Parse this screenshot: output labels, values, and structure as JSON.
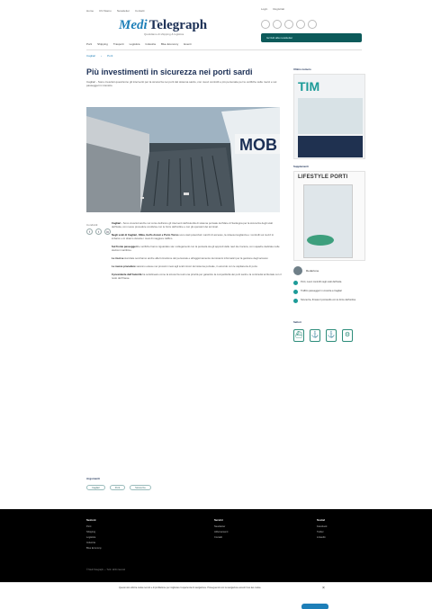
{
  "topbar": {
    "links": [
      "Home",
      "Chi Siamo",
      "Newsletter",
      "Contatti"
    ],
    "right_links": [
      "Login",
      "Registrati"
    ]
  },
  "header": {
    "logo_part1": "Medi",
    "logo_part2": "Telegraph",
    "tagline": "Quotidiano di shipping & logistica",
    "subscribe_label": "Iscriviti alla newsletter"
  },
  "nav": {
    "items": [
      "Porti",
      "Shipping",
      "Trasporti",
      "Logistica",
      "Industria",
      "Blue Economy",
      "Eventi"
    ]
  },
  "breadcrumbs": [
    "Cagliari",
    "Porti"
  ],
  "article": {
    "title": "Più investimenti in sicurezza nei porti sardi",
    "lead": "Cagliari - Sono cresciuti quest'anno gli interventi per la sicurezza nei porti del sistema sardo, con nuovi controlli e più personale per le verifiche sulle merci e sui passeggeri in transito.",
    "share_label": "Condividi",
    "share_icons": [
      "facebook-icon",
      "twitter-icon",
      "linkedin-icon"
    ],
    "paragraphs": [
      {
        "strong": "Cagliari - ",
        "text": "Sono cresciuti anche nel corso dell'anno gli interventi dell'Autorità di sistema portuale del Mare di Sardegna per la sicurezza degli scali dell'isola, con nuove procedure condivise con le forze dell'ordine e con gli operatori dei terminal."
      },
      {
        "strong": "Negli scali di Cagliari, Olbia, Golfo Aranci e Porto Torres ",
        "text": "sono stati potenziati i varchi di accesso, la videosorveglianza e i controlli sui mezzi in imbarco e in sbarco durante i mesi di maggiore traffico."
      },
      {
        "strong": "Sul fronte passeggeri ",
        "text": "le verifiche hanno riguardato sia i collegamenti con la penisola sia gli approdi delle navi da crociera, con squadre dedicate nelle stazioni marittime."
      },
      {
        "strong": "Le risorse ",
        "text": "stanziate serviranno anche alla formazione del personale e all'aggiornamento dei sistemi informatici per la gestione degli accessi."
      },
      {
        "strong": "Le nuove procedure ",
        "text": "saranno estese nei prossimi mesi agli scali minori del sistema portuale, in accordo con le capitanerie di porto."
      },
      {
        "strong": "Il presidente dell'Autorità ",
        "text": "ha sottolineato come la sicurezza resti una priorità per garantire la competitività dei porti sardi e la continuità territoriale con il resto del Paese."
      }
    ]
  },
  "tags": {
    "label": "Argomenti",
    "items": [
      "Cagliari",
      "Porti",
      "Sicurezza"
    ]
  },
  "sidebar": {
    "section1_label": "Ultimo numero",
    "ad1_title": "TIM",
    "section2_label": "Supplementi",
    "ad2_title": "LIFESTYLE PORTI",
    "author_name": "Redazione",
    "related": [
      "Porti, nuovi controlli negli scali dell'isola",
      "Traffico passeggeri in crescita a Cagliari",
      "Sicurezza, firmato il protocollo con le forze dell'ordine"
    ],
    "icons_label": "Settori",
    "sector_icons": [
      "ship-icon",
      "port-icon",
      "anchor-icon",
      "industry-icon",
      "wind-icon",
      "leaf-icon"
    ]
  },
  "footer": {
    "col1_title": "Sezioni",
    "col1_items": [
      "Porti",
      "Shipping",
      "Logistica",
      "Industria",
      "Blue Economy"
    ],
    "col2_title": "Servizi",
    "col2_items": [
      "Newsletter",
      "Abbonamenti",
      "Contatti"
    ],
    "col3_title": "Social",
    "col3_items": [
      "Facebook",
      "Twitter",
      "LinkedIn"
    ],
    "note": "© Medi Telegraph — Tutti i diritti riservati"
  },
  "cookie": {
    "text": "Questo sito utilizza cookie tecnici e di profilazione per migliorare l'esperienza di navigazione. Proseguendo con la navigazione accetti l'uso dei cookie.",
    "close": "×"
  }
}
